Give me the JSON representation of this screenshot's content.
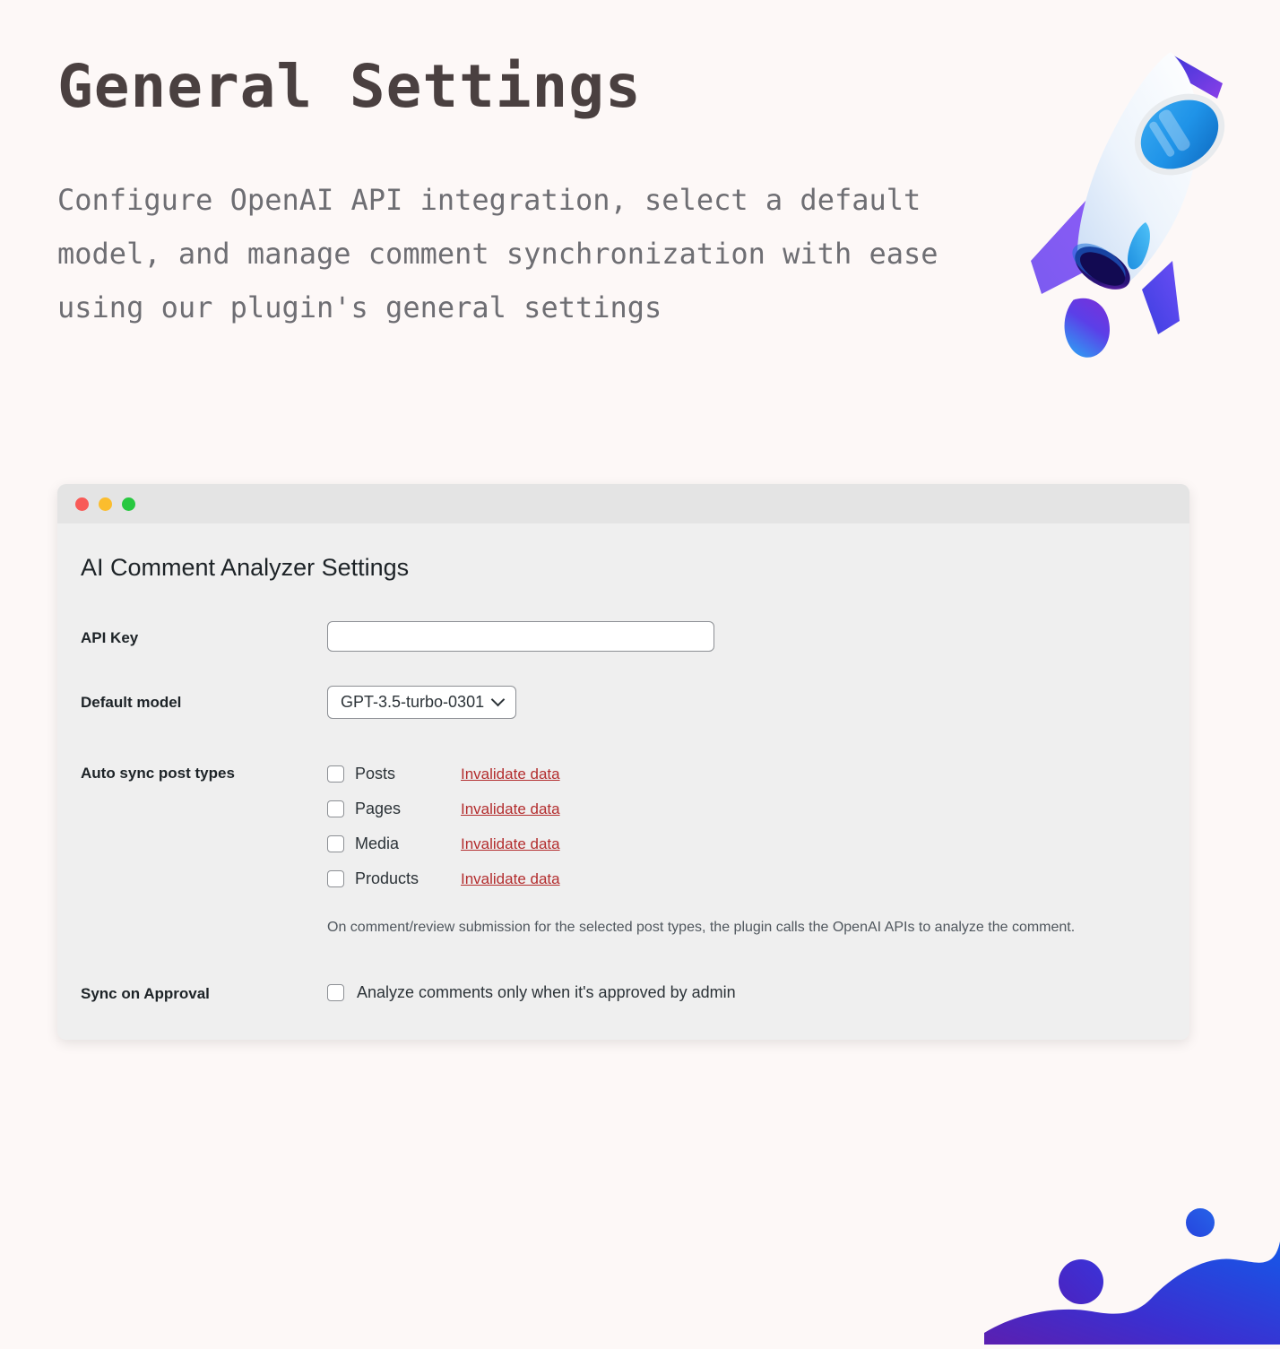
{
  "hero": {
    "title": "General Settings",
    "subtitle": "Configure OpenAI API integration, select a default model, and manage comment synchronization with ease using our plugin's general settings",
    "illustration": "rocket-illustration"
  },
  "window": {
    "traffic_lights": [
      {
        "name": "close",
        "color": "#F85A57"
      },
      {
        "name": "minimize",
        "color": "#FBBD2E"
      },
      {
        "name": "zoom",
        "color": "#28C840"
      }
    ]
  },
  "panel": {
    "title": "AI Comment Analyzer Settings",
    "fields": {
      "api_key": {
        "label": "API Key",
        "value": "",
        "placeholder": ""
      },
      "default_model": {
        "label": "Default model",
        "selected": "GPT-3.5-turbo-0301",
        "options": [
          "GPT-3.5-turbo-0301"
        ]
      },
      "auto_sync": {
        "label": "Auto sync post types",
        "items": [
          {
            "label": "Posts",
            "checked": false,
            "action": "Invalidate data"
          },
          {
            "label": "Pages",
            "checked": false,
            "action": "Invalidate data"
          },
          {
            "label": "Media",
            "checked": false,
            "action": "Invalidate data"
          },
          {
            "label": "Products",
            "checked": false,
            "action": "Invalidate data"
          }
        ],
        "help": "On comment/review submission for the selected post types, the plugin calls the OpenAI APIs to analyze the comment."
      },
      "sync_on_approval": {
        "label": "Sync on Approval",
        "checkbox_label": "Analyze comments only when it's approved by admin",
        "checked": false
      }
    }
  },
  "colors": {
    "page_background": "#FDF8F7",
    "card_background": "#EFEFEF",
    "titlebar_background": "#E4E4E4",
    "heading": "#4A4040",
    "subtitle": "#6E6E73",
    "link_danger": "#B32D2E",
    "accent_blue": "#2563E0",
    "accent_purple": "#5B2CD6"
  }
}
